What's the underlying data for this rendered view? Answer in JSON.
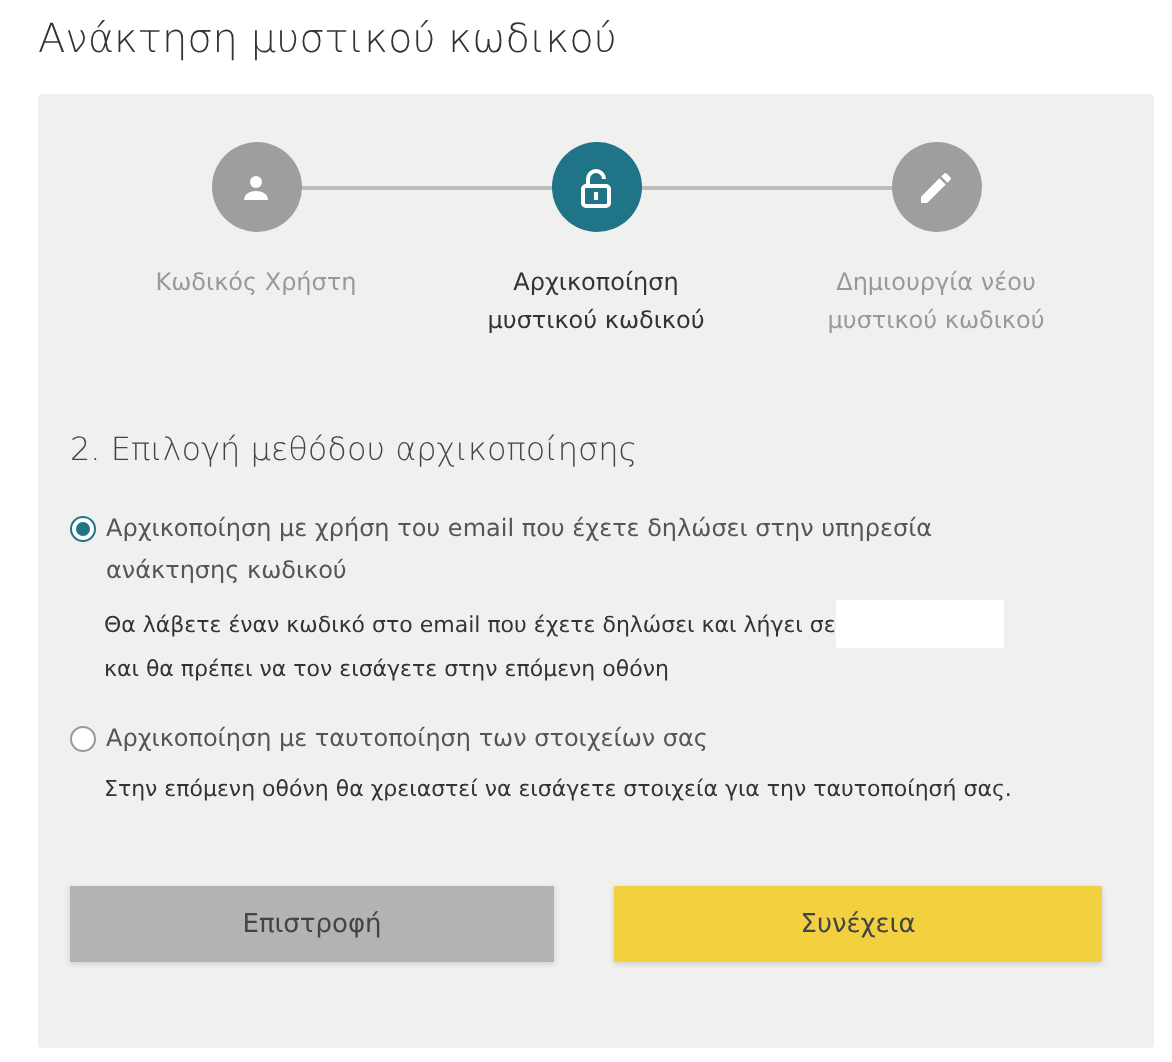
{
  "title": "Ανάκτηση μυστικού κωδικού",
  "steps": [
    {
      "label": "Κωδικός Χρήστη",
      "selected": false
    },
    {
      "label": "Αρχικοποίηση μυστικού κωδικού",
      "selected": true
    },
    {
      "label": "Δημιουργία νέου μυστικού κωδικού",
      "selected": false
    }
  ],
  "section_heading": "2. Επιλογή μεθόδου αρχικοποίησης",
  "options": [
    {
      "label": "Αρχικοποίηση με χρήση του email που έχετε δηλώσει στην υπηρεσία ανάκτησης κωδικού",
      "selected": true,
      "detail": "Θα λάβετε έναν κωδικό στο email που έχετε δηλώσει και λήγει σε",
      "detail_2": "και θα πρέπει να τον εισάγετε στην επόμενη οθόνη"
    },
    {
      "label": "Αρχικοποίηση με ταυτοποίηση των στοιχείων σας",
      "selected": false,
      "detail": "Στην επόμενη οθόνη θα χρειαστεί να εισάγετε στοιχεία για την ταυτοποίησή σας."
    }
  ],
  "buttons": [
    {
      "label": "Επιστροφή",
      "kind": "secondary"
    },
    {
      "label": "Συνέχεια",
      "kind": "primary"
    }
  ]
}
